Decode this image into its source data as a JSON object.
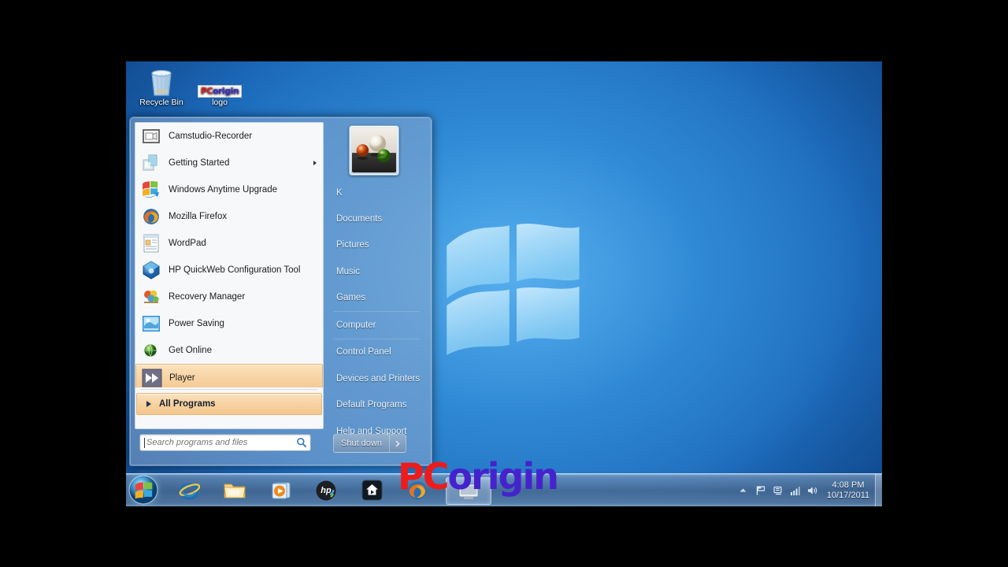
{
  "desktop": {
    "icons": [
      {
        "name": "Recycle Bin",
        "icon": "recycle-bin-icon"
      },
      {
        "name": "logo",
        "icon": "pcorigin-logo-image",
        "badge_red": "PC",
        "badge_blue": "origin"
      }
    ],
    "wallpaper": "windows-7-default-blue",
    "watermark": {
      "red": "PC",
      "blue": "origin"
    }
  },
  "start_menu": {
    "programs": [
      {
        "label": "Camstudio-Recorder",
        "icon": "camstudio-icon",
        "submenu": false,
        "selected": false
      },
      {
        "label": "Getting Started",
        "icon": "getting-started-icon",
        "submenu": true,
        "selected": false
      },
      {
        "label": "Windows Anytime Upgrade",
        "icon": "windows-anytime-upgrade-icon",
        "submenu": false,
        "selected": false
      },
      {
        "label": "Mozilla Firefox",
        "icon": "firefox-icon",
        "submenu": false,
        "selected": false
      },
      {
        "label": "WordPad",
        "icon": "wordpad-icon",
        "submenu": false,
        "selected": false
      },
      {
        "label": "HP QuickWeb Configuration Tool",
        "icon": "hp-quickweb-icon",
        "submenu": false,
        "selected": false
      },
      {
        "label": "Recovery Manager",
        "icon": "recovery-manager-icon",
        "submenu": false,
        "selected": false
      },
      {
        "label": "Power Saving",
        "icon": "power-saving-icon",
        "submenu": false,
        "selected": false
      },
      {
        "label": "Get Online",
        "icon": "get-online-icon",
        "submenu": false,
        "selected": false
      },
      {
        "label": "Player",
        "icon": "player-icon",
        "submenu": false,
        "selected": true
      }
    ],
    "all_programs": {
      "label": "All Programs",
      "icon": "right-triangle-icon"
    },
    "search": {
      "placeholder": "Search programs and files",
      "value": "",
      "icon": "search-icon"
    },
    "user": {
      "name": "K",
      "picture": "marbles-avatar"
    },
    "right_items": [
      {
        "label": "Documents"
      },
      {
        "label": "Pictures"
      },
      {
        "label": "Music"
      },
      {
        "label": "Games"
      },
      {
        "label": "Computer"
      },
      {
        "label": "Control Panel"
      },
      {
        "label": "Devices and Printers"
      },
      {
        "label": "Default Programs"
      },
      {
        "label": "Help and Support"
      }
    ],
    "shutdown": {
      "label": "Shut down",
      "arrow_icon": "chevron-right-icon"
    }
  },
  "taskbar": {
    "start_orb": "windows-start-orb",
    "buttons": [
      {
        "name": "internet-explorer",
        "active": false
      },
      {
        "name": "windows-explorer",
        "active": false
      },
      {
        "name": "windows-media-player",
        "active": false
      },
      {
        "name": "hp-support-assistant",
        "active": false
      },
      {
        "name": "media-center",
        "active": false
      },
      {
        "name": "mozilla-firefox",
        "active": false
      },
      {
        "name": "camstudio-window",
        "active": true
      }
    ],
    "tray": {
      "show_hidden_icons": "chevron-up-icon",
      "action_center": "flag-icon",
      "network": "network-icon",
      "signal": "signal-bars-icon",
      "volume": "speaker-icon"
    },
    "clock": {
      "time": "4:08 PM",
      "date": "10/17/2011"
    }
  }
}
